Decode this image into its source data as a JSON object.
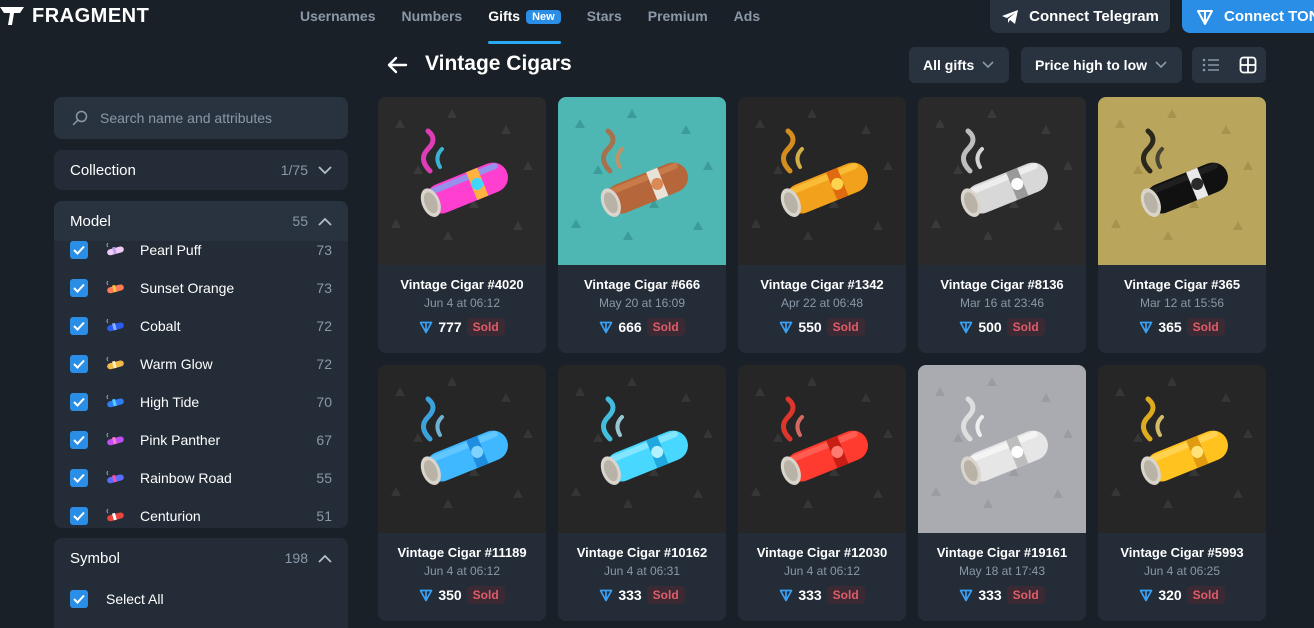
{
  "brand": {
    "name": "FRAGMENT"
  },
  "nav": {
    "items": [
      {
        "label": "Usernames"
      },
      {
        "label": "Numbers"
      },
      {
        "label": "Gifts",
        "badge": "New"
      },
      {
        "label": "Stars"
      },
      {
        "label": "Premium"
      },
      {
        "label": "Ads"
      }
    ],
    "active": "Gifts"
  },
  "actions": {
    "telegram_label": "Connect Telegram",
    "ton_label": "Connect TON"
  },
  "page": {
    "title": "Vintage Cigars",
    "filter_label": "All gifts",
    "sort_label": "Price high to low"
  },
  "sidebar": {
    "search_placeholder": "Search name and attributes",
    "collection": {
      "label": "Collection",
      "count": "1/75"
    },
    "model": {
      "label": "Model",
      "count": "55",
      "items": [
        {
          "label": "Pearl Puff",
          "count": "73",
          "colors": [
            "#f3c9f7",
            "#b9a4f0"
          ]
        },
        {
          "label": "Sunset Orange",
          "count": "73",
          "colors": [
            "#ff7a59",
            "#f6c343"
          ]
        },
        {
          "label": "Cobalt",
          "count": "72",
          "colors": [
            "#2b5cf0",
            "#8ab0ff"
          ]
        },
        {
          "label": "Warm Glow",
          "count": "72",
          "colors": [
            "#f5b94a",
            "#fff1b8"
          ]
        },
        {
          "label": "High Tide",
          "count": "70",
          "colors": [
            "#2f7cf6",
            "#52d0ff"
          ]
        },
        {
          "label": "Pink Panther",
          "count": "67",
          "colors": [
            "#c04ef2",
            "#ff79c6"
          ]
        },
        {
          "label": "Rainbow Road",
          "count": "55",
          "colors": [
            "#5a6cff",
            "#ff4fa0"
          ]
        },
        {
          "label": "Centurion",
          "count": "51",
          "colors": [
            "#e8453c",
            "#ffffff"
          ]
        }
      ]
    },
    "symbol": {
      "label": "Symbol",
      "count": "198",
      "select_all": "Select All"
    }
  },
  "gifts": [
    {
      "name": "Vintage Cigar #4020",
      "date": "Jun 4 at 06:12",
      "price": "777",
      "status": "Sold",
      "bg": "#2a2a2a",
      "pattern": "#3a3a3a",
      "colors": [
        "#ff3fd0",
        "#3fd6ff",
        "#ffb23f"
      ]
    },
    {
      "name": "Vintage Cigar #666",
      "date": "May 20 at 16:09",
      "price": "666",
      "status": "Sold",
      "bg": "#4fb7b3",
      "pattern": "#3c9c99",
      "colors": [
        "#b5663b",
        "#d98a55",
        "#e8e2d8"
      ]
    },
    {
      "name": "Vintage Cigar #1342",
      "date": "Apr 22 at 06:48",
      "price": "550",
      "status": "Sold",
      "bg": "#262626",
      "pattern": "#363636",
      "colors": [
        "#f2a11c",
        "#ffd34d",
        "#e06a10"
      ]
    },
    {
      "name": "Vintage Cigar #8136",
      "date": "Mar 16 at 23:46",
      "price": "500",
      "status": "Sold",
      "bg": "#2a2a2a",
      "pattern": "#3a3a3a",
      "colors": [
        "#d8d8d8",
        "#ffffff",
        "#9a9a9a"
      ]
    },
    {
      "name": "Vintage Cigar #365",
      "date": "Mar 12 at 15:56",
      "price": "365",
      "status": "Sold",
      "bg": "#b9a55c",
      "pattern": "#a8934c",
      "colors": [
        "#111111",
        "#2b2b2b",
        "#e9e9e9"
      ]
    },
    {
      "name": "Vintage Cigar #11189",
      "date": "Jun 4 at 06:12",
      "price": "350",
      "status": "Sold",
      "bg": "#262626",
      "pattern": "#363636",
      "colors": [
        "#3fb8ff",
        "#7fd4ff",
        "#1f8ee0"
      ]
    },
    {
      "name": "Vintage Cigar #10162",
      "date": "Jun 4 at 06:31",
      "price": "333",
      "status": "Sold",
      "bg": "#262626",
      "pattern": "#363636",
      "colors": [
        "#48d8ff",
        "#b5f0ff",
        "#1fa9e0"
      ]
    },
    {
      "name": "Vintage Cigar #12030",
      "date": "Jun 4 at 06:12",
      "price": "333",
      "status": "Sold",
      "bg": "#262626",
      "pattern": "#363636",
      "colors": [
        "#ff3a2f",
        "#ff7a6f",
        "#c81e16"
      ]
    },
    {
      "name": "Vintage Cigar #19161",
      "date": "May 18 at 17:43",
      "price": "333",
      "status": "Sold",
      "bg": "#a9abb0",
      "pattern": "#9a9ca1",
      "colors": [
        "#e6e6e6",
        "#ffffff",
        "#bdbdbd"
      ]
    },
    {
      "name": "Vintage Cigar #5993",
      "date": "Jun 4 at 06:25",
      "price": "320",
      "status": "Sold",
      "bg": "#262626",
      "pattern": "#363636",
      "colors": [
        "#ffc21f",
        "#ffe27a",
        "#e09b10"
      ]
    }
  ]
}
